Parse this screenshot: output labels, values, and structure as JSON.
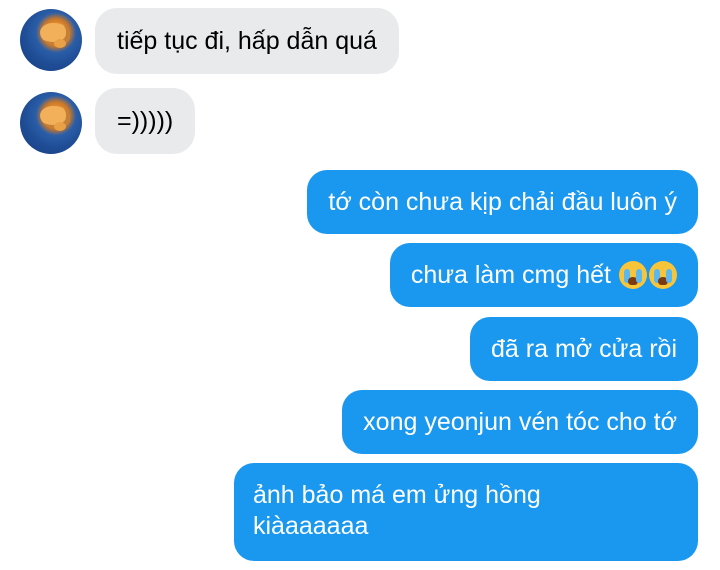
{
  "conversation": {
    "incoming": [
      {
        "text": "tiếp tục đi, hấp dẫn quá"
      },
      {
        "text": "=)))))"
      }
    ],
    "outgoing": [
      {
        "text": "tớ còn chưa kịp chải đầu luôn ý"
      },
      {
        "text": "chưa làm cmg hết",
        "emoji": "loudly-crying-face x2"
      },
      {
        "text": "đã ra mở cửa rồi"
      },
      {
        "text": "xong yeonjun vén tóc cho tớ"
      },
      {
        "line1": "ảnh bảo má em ửng hồng",
        "line2": "kiàaaaaaa"
      }
    ]
  },
  "colors": {
    "incoming_bubble": "#e9eaec",
    "outgoing_bubble": "#1a98f0",
    "outgoing_text": "#ffffff"
  }
}
